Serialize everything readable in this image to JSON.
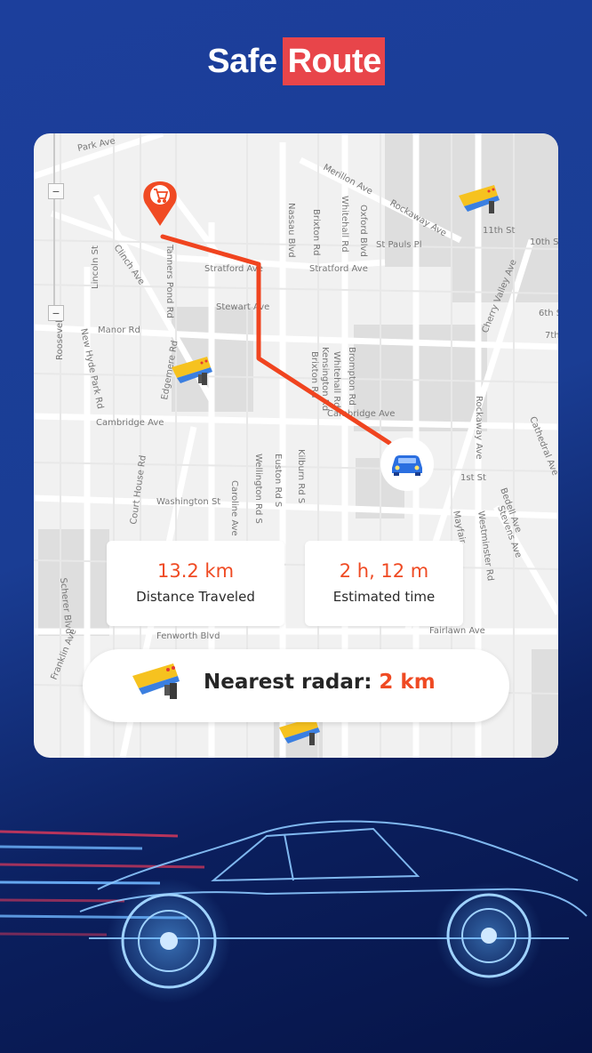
{
  "brand": {
    "name_part1": "Safe",
    "name_part2": "Route",
    "accent_color": "#e8454a"
  },
  "map": {
    "street_labels": [
      "Park Ave",
      "Merillon Ave",
      "Rockaway Ave",
      "Whitehall Rd",
      "Oxford Blvd",
      "Brixton Rd",
      "Nassau Blvd",
      "St Pauls Pl",
      "11th St",
      "10th St",
      "Clinch Ave",
      "Tanners Pond Rd",
      "Lincoln St",
      "Stratford Ave",
      "Stratford Ave",
      "Stewart Ave",
      "Cherry Valley Ave",
      "Manor Rd",
      "New Hyde Park Rd",
      "Roosevelt St",
      "Edgemere Rd",
      "Brompton Rd",
      "Kensington Rd",
      "Whitehall Rd",
      "Brixton Rd",
      "Cambridge Ave",
      "Cambridge Ave",
      "Rockaway Ave",
      "Cathedral Ave",
      "Court House Rd",
      "Wellington Rd S",
      "Euston Rd S",
      "Kilburn Rd S",
      "Washington St",
      "Caroline Ave",
      "1st St",
      "Bedell Ave",
      "Stevens Ave",
      "Westminster Rd",
      "Scherer Blvd",
      "Franklin Ave",
      "Fenworth Blvd",
      "Fairlawn Ave",
      "6th St",
      "7th St",
      "Mayfair"
    ],
    "zoom_in": "−",
    "zoom_out": "−"
  },
  "stats": {
    "distance": {
      "value": "13.2 km",
      "label": "Distance Traveled"
    },
    "time": {
      "value": "2 h, 12 m",
      "label": "Estimated time"
    }
  },
  "radar": {
    "label": "Nearest radar:",
    "value": "2 km"
  },
  "colors": {
    "route": "#f0441f",
    "accent": "#ef4a23",
    "marker": "#f04a23",
    "car": "#2b6fe0"
  }
}
